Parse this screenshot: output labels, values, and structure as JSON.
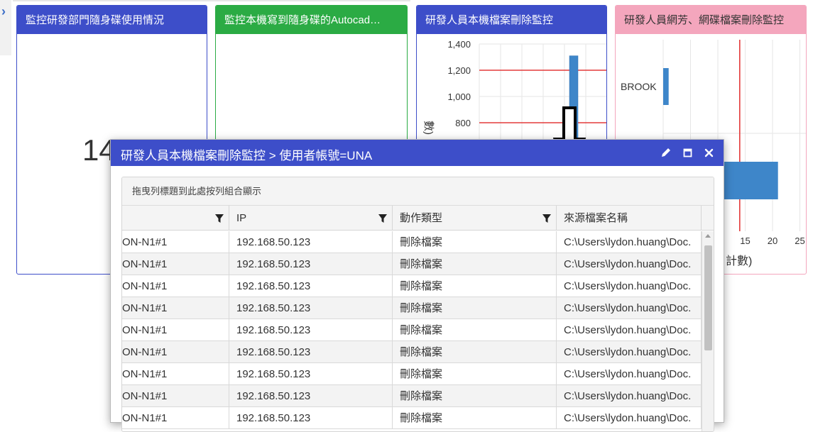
{
  "left_nav": {
    "toggle_glyph": "›"
  },
  "cards": [
    {
      "title": "監控研發部門隨身碟使用情況",
      "color": "#3d4ec9",
      "big_number": "14"
    },
    {
      "title": "監控本機寫到隨身碟的Autocad…",
      "color": "#2bab44"
    },
    {
      "title": "研發人員本機檔案刪除監控",
      "color": "#3d4ec9"
    },
    {
      "title": "研發人員網芳、網碟檔案刪除監控",
      "color": "#f4a6bd",
      "title_color": "#333333"
    }
  ],
  "chart_data": [
    {
      "type": "bar",
      "title": "研發人員本機檔案刪除監控",
      "ylabel": "數)",
      "yticks": [
        "1,400",
        "1,200",
        "1,000",
        "800"
      ],
      "ylim": [
        800,
        1400
      ],
      "reference_lines": [
        1200,
        800
      ],
      "series": [
        {
          "values": [
            1310
          ]
        }
      ],
      "bar_color": "#3e86c9",
      "reference_color": "#e33b3b"
    },
    {
      "type": "bar",
      "orientation": "horizontal",
      "title": "研發人員網芳、網碟檔案刪除監控",
      "categories": [
        "BROOK",
        ""
      ],
      "values": [
        1,
        21
      ],
      "xticks": [
        "15",
        "20",
        "25"
      ],
      "xlim": [
        0,
        25
      ],
      "xlabel": "計數)",
      "reference_line": 14,
      "bar_color": "#3e86c9",
      "reference_color": "#e33b3b"
    }
  ],
  "modal": {
    "title": "研發人員本機檔案刪除監控 > 使用者帳號=UNA",
    "tools": {
      "edit": "pencil-icon",
      "maximize": "maximize-icon",
      "close": "close-icon"
    },
    "group_hint": "拖曳列標題到此處按列組合顯示",
    "columns": [
      "",
      "IP",
      "動作類型",
      "來源檔案名稱"
    ],
    "rows": [
      [
        "ON-N1#1",
        "192.168.50.123",
        "刪除檔案",
        "C:\\Users\\lydon.huang\\Doc."
      ],
      [
        "ON-N1#1",
        "192.168.50.123",
        "刪除檔案",
        "C:\\Users\\lydon.huang\\Doc."
      ],
      [
        "ON-N1#1",
        "192.168.50.123",
        "刪除檔案",
        "C:\\Users\\lydon.huang\\Doc."
      ],
      [
        "ON-N1#1",
        "192.168.50.123",
        "刪除檔案",
        "C:\\Users\\lydon.huang\\Doc."
      ],
      [
        "ON-N1#1",
        "192.168.50.123",
        "刪除檔案",
        "C:\\Users\\lydon.huang\\Doc."
      ],
      [
        "ON-N1#1",
        "192.168.50.123",
        "刪除檔案",
        "C:\\Users\\lydon.huang\\Doc."
      ],
      [
        "ON-N1#1",
        "192.168.50.123",
        "刪除檔案",
        "C:\\Users\\lydon.huang\\Doc."
      ],
      [
        "ON-N1#1",
        "192.168.50.123",
        "刪除檔案",
        "C:\\Users\\lydon.huang\\Doc."
      ],
      [
        "ON-N1#1",
        "192.168.50.123",
        "刪除檔案",
        "C:\\Users\\lydon.huang\\Doc."
      ]
    ]
  }
}
